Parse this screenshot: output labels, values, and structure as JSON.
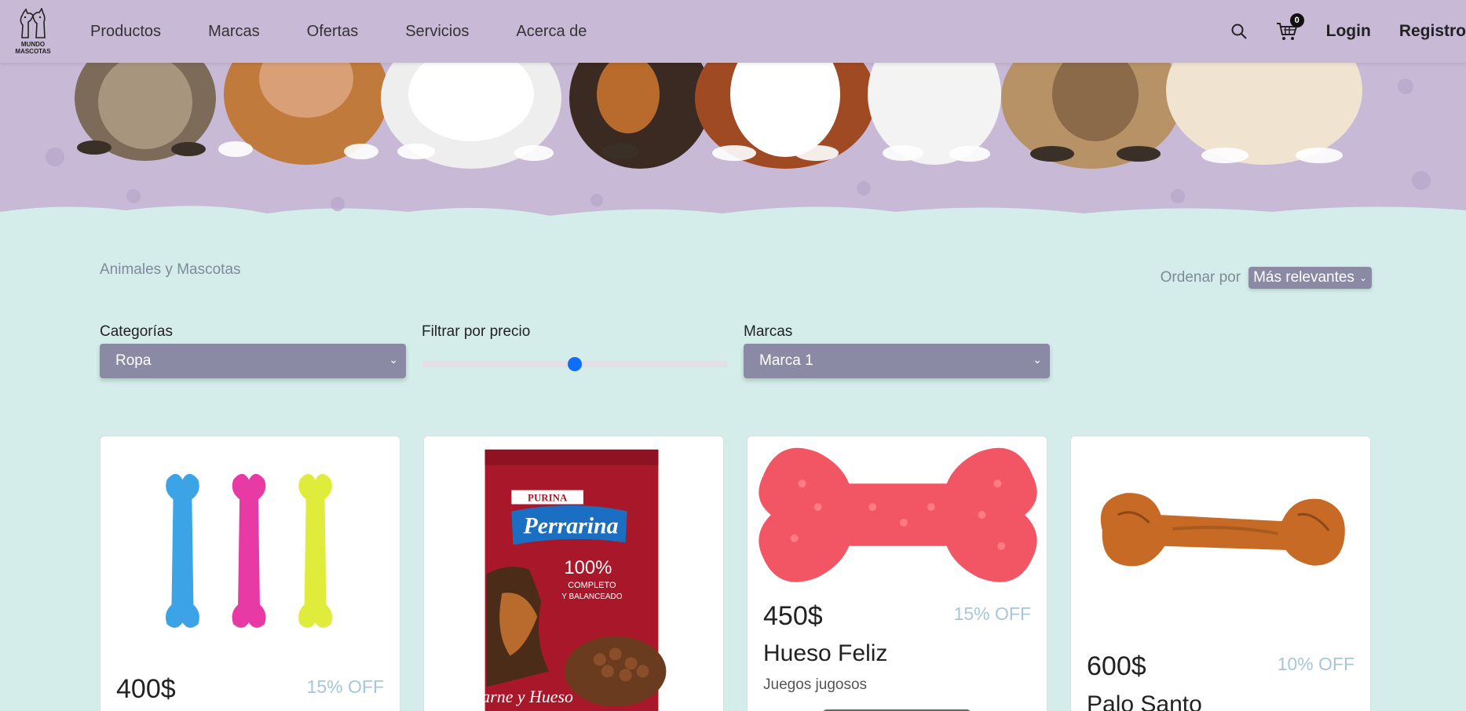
{
  "header": {
    "logo_text_line1": "MUNDO",
    "logo_text_line2": "MASCOTAS",
    "nav": [
      "Productos",
      "Marcas",
      "Ofertas",
      "Servicios",
      "Acerca de"
    ],
    "cart_count": "0",
    "login": "Login",
    "register": "Registro"
  },
  "breadcrumb": "Animales y Mascotas",
  "sort": {
    "label": "Ordenar por",
    "value": "Más relevantes"
  },
  "filters": {
    "categories_label": "Categorías",
    "categories_value": "Ropa",
    "price_label": "Filtrar por precio",
    "price_level": 0.5,
    "brands_label": "Marcas",
    "brands_value": "Marca 1"
  },
  "products": [
    {
      "price": "400$",
      "discount": "15% OFF",
      "image_icon": "colorful-bones-icon"
    },
    {
      "image_icon": "dog-food-bag-icon",
      "bag_brand": "PURINA",
      "bag_name": "Perrarina",
      "bag_claim_1": "100%",
      "bag_claim_2": "COMPLETO",
      "bag_claim_3": "Y BALANCEADO",
      "bag_flavor": "Carne y Hueso"
    },
    {
      "price": "450$",
      "discount": "15% OFF",
      "title": "Hueso Feliz",
      "subtitle": "Juegos jugosos",
      "image_icon": "spiky-bone-icon"
    },
    {
      "price": "600$",
      "discount": "10% OFF",
      "title": "Palo Santo",
      "image_icon": "chew-bone-icon"
    }
  ],
  "colors": {
    "header_bg": "#c8b9d6",
    "page_bg": "#d4edea",
    "select_bg": "#8a8aa5",
    "slider_thumb": "#0d6efd",
    "discount": "#a7c7d9"
  }
}
